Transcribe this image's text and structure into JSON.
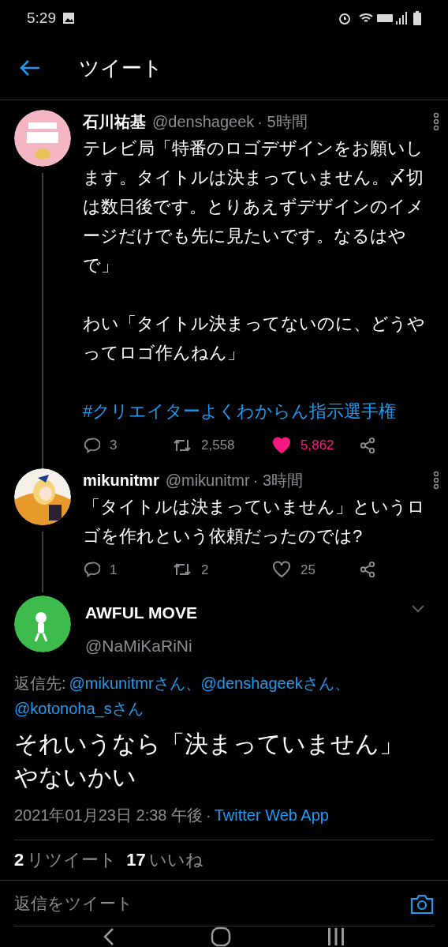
{
  "status_bar": {
    "time": "5:29"
  },
  "header": {
    "title": "ツイート"
  },
  "thread": [
    {
      "name": "石川祐基",
      "handle": "@denshageek",
      "time": "· 5時間",
      "paragraphs": [
        "テレビ局「特番のロゴデザインをお願いします。タイトルは決まっていません。〆切は数日後です。とりあえずデザインのイメージだけでも先に見たいです。なるはやで」",
        "わい「タイトル決まってないのに、どうやってロゴ作んねん」"
      ],
      "hashtag": "#クリエイターよくわからん指示選手権",
      "replies": "3",
      "retweets": "2,558",
      "likes": "5,862",
      "liked": true
    },
    {
      "name": "mikunitmr",
      "handle": "@mikunitmr",
      "time": "· 3時間",
      "paragraphs": [
        "「タイトルは決まっていません」というロゴを作れという依頼だったのでは?"
      ],
      "replies": "1",
      "retweets": "2",
      "likes": "25",
      "liked": false
    }
  ],
  "main_tweet": {
    "name": "AWFUL MOVE",
    "handle": "@NaMiKaRiNi",
    "reply_to_label": "返信先:",
    "reply_to": [
      "@mikunitmrさん、",
      "@denshageekさん、",
      "@kotonoha_sさん"
    ],
    "text": "それいうなら「決まっていません」やないかい",
    "date": "2021年01月23日 2:38 午後",
    "separator": "·",
    "source": "Twitter Web App",
    "stats": [
      {
        "count": "2",
        "label": "リツイート"
      },
      {
        "count": "17",
        "label": "いいね"
      }
    ]
  },
  "reply_bar": {
    "placeholder": "返信をツイート"
  }
}
